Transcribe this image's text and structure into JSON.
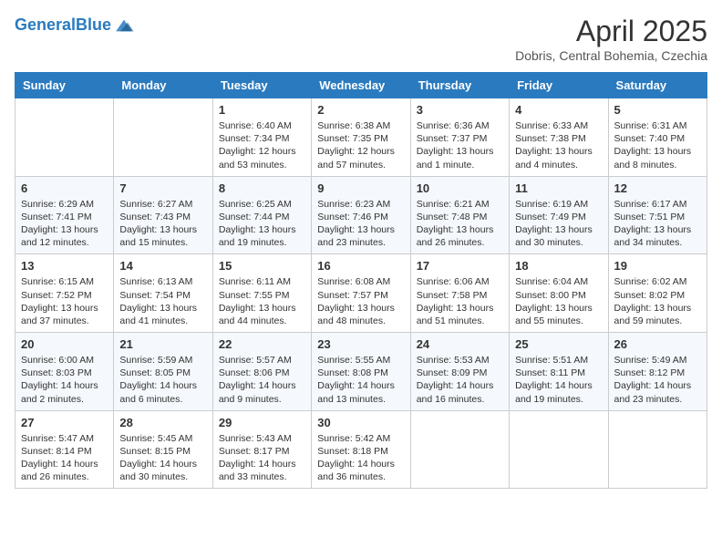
{
  "header": {
    "logo_line1": "General",
    "logo_line2": "Blue",
    "month": "April 2025",
    "location": "Dobris, Central Bohemia, Czechia"
  },
  "weekdays": [
    "Sunday",
    "Monday",
    "Tuesday",
    "Wednesday",
    "Thursday",
    "Friday",
    "Saturday"
  ],
  "weeks": [
    [
      {
        "day": "",
        "content": ""
      },
      {
        "day": "",
        "content": ""
      },
      {
        "day": "1",
        "content": "Sunrise: 6:40 AM\nSunset: 7:34 PM\nDaylight: 12 hours and 53 minutes."
      },
      {
        "day": "2",
        "content": "Sunrise: 6:38 AM\nSunset: 7:35 PM\nDaylight: 12 hours and 57 minutes."
      },
      {
        "day": "3",
        "content": "Sunrise: 6:36 AM\nSunset: 7:37 PM\nDaylight: 13 hours and 1 minute."
      },
      {
        "day": "4",
        "content": "Sunrise: 6:33 AM\nSunset: 7:38 PM\nDaylight: 13 hours and 4 minutes."
      },
      {
        "day": "5",
        "content": "Sunrise: 6:31 AM\nSunset: 7:40 PM\nDaylight: 13 hours and 8 minutes."
      }
    ],
    [
      {
        "day": "6",
        "content": "Sunrise: 6:29 AM\nSunset: 7:41 PM\nDaylight: 13 hours and 12 minutes."
      },
      {
        "day": "7",
        "content": "Sunrise: 6:27 AM\nSunset: 7:43 PM\nDaylight: 13 hours and 15 minutes."
      },
      {
        "day": "8",
        "content": "Sunrise: 6:25 AM\nSunset: 7:44 PM\nDaylight: 13 hours and 19 minutes."
      },
      {
        "day": "9",
        "content": "Sunrise: 6:23 AM\nSunset: 7:46 PM\nDaylight: 13 hours and 23 minutes."
      },
      {
        "day": "10",
        "content": "Sunrise: 6:21 AM\nSunset: 7:48 PM\nDaylight: 13 hours and 26 minutes."
      },
      {
        "day": "11",
        "content": "Sunrise: 6:19 AM\nSunset: 7:49 PM\nDaylight: 13 hours and 30 minutes."
      },
      {
        "day": "12",
        "content": "Sunrise: 6:17 AM\nSunset: 7:51 PM\nDaylight: 13 hours and 34 minutes."
      }
    ],
    [
      {
        "day": "13",
        "content": "Sunrise: 6:15 AM\nSunset: 7:52 PM\nDaylight: 13 hours and 37 minutes."
      },
      {
        "day": "14",
        "content": "Sunrise: 6:13 AM\nSunset: 7:54 PM\nDaylight: 13 hours and 41 minutes."
      },
      {
        "day": "15",
        "content": "Sunrise: 6:11 AM\nSunset: 7:55 PM\nDaylight: 13 hours and 44 minutes."
      },
      {
        "day": "16",
        "content": "Sunrise: 6:08 AM\nSunset: 7:57 PM\nDaylight: 13 hours and 48 minutes."
      },
      {
        "day": "17",
        "content": "Sunrise: 6:06 AM\nSunset: 7:58 PM\nDaylight: 13 hours and 51 minutes."
      },
      {
        "day": "18",
        "content": "Sunrise: 6:04 AM\nSunset: 8:00 PM\nDaylight: 13 hours and 55 minutes."
      },
      {
        "day": "19",
        "content": "Sunrise: 6:02 AM\nSunset: 8:02 PM\nDaylight: 13 hours and 59 minutes."
      }
    ],
    [
      {
        "day": "20",
        "content": "Sunrise: 6:00 AM\nSunset: 8:03 PM\nDaylight: 14 hours and 2 minutes."
      },
      {
        "day": "21",
        "content": "Sunrise: 5:59 AM\nSunset: 8:05 PM\nDaylight: 14 hours and 6 minutes."
      },
      {
        "day": "22",
        "content": "Sunrise: 5:57 AM\nSunset: 8:06 PM\nDaylight: 14 hours and 9 minutes."
      },
      {
        "day": "23",
        "content": "Sunrise: 5:55 AM\nSunset: 8:08 PM\nDaylight: 14 hours and 13 minutes."
      },
      {
        "day": "24",
        "content": "Sunrise: 5:53 AM\nSunset: 8:09 PM\nDaylight: 14 hours and 16 minutes."
      },
      {
        "day": "25",
        "content": "Sunrise: 5:51 AM\nSunset: 8:11 PM\nDaylight: 14 hours and 19 minutes."
      },
      {
        "day": "26",
        "content": "Sunrise: 5:49 AM\nSunset: 8:12 PM\nDaylight: 14 hours and 23 minutes."
      }
    ],
    [
      {
        "day": "27",
        "content": "Sunrise: 5:47 AM\nSunset: 8:14 PM\nDaylight: 14 hours and 26 minutes."
      },
      {
        "day": "28",
        "content": "Sunrise: 5:45 AM\nSunset: 8:15 PM\nDaylight: 14 hours and 30 minutes."
      },
      {
        "day": "29",
        "content": "Sunrise: 5:43 AM\nSunset: 8:17 PM\nDaylight: 14 hours and 33 minutes."
      },
      {
        "day": "30",
        "content": "Sunrise: 5:42 AM\nSunset: 8:18 PM\nDaylight: 14 hours and 36 minutes."
      },
      {
        "day": "",
        "content": ""
      },
      {
        "day": "",
        "content": ""
      },
      {
        "day": "",
        "content": ""
      }
    ]
  ]
}
